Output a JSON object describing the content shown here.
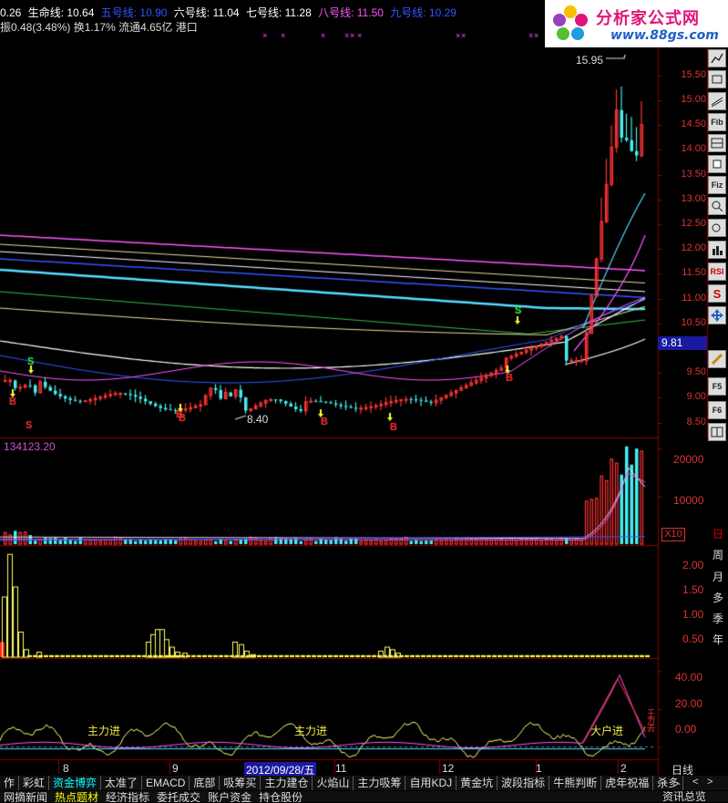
{
  "header": {
    "lines": [
      {
        "label": "0.26",
        "color": "#ffffff"
      },
      {
        "label": "生命线: 10.64",
        "color": "#ffffff"
      },
      {
        "label": "五号线: 10.90",
        "color": "#3355ff"
      },
      {
        "label": "六号线: 11.04",
        "color": "#ffffff"
      },
      {
        "label": "七号线: 11.28",
        "color": "#ffffff"
      },
      {
        "label": "八号线: 11.50",
        "color": "#ff55ff"
      },
      {
        "label": "九号线: 10.29",
        "color": "#3355ff"
      }
    ],
    "info_line": "振0.48(3.48%) 换1.17% 流通4.65亿 港口"
  },
  "logo": {
    "name": "分析家公式网",
    "url": "www.88gs.com"
  },
  "price_axis": {
    "labels": [
      "15.50",
      "15.00",
      "14.50",
      "14.00",
      "13.50",
      "13.00",
      "12.50",
      "12.00",
      "11.50",
      "11.00",
      "10.50",
      "10.00",
      "9.50",
      "9.00",
      "8.50"
    ],
    "current_price": "9.81",
    "high_label": "15.95",
    "low_label": "8.40"
  },
  "volume_panel": {
    "value_label": "134123.20",
    "axis_labels": [
      "20000",
      "10000"
    ],
    "unit_label": "X10"
  },
  "indicator_panel": {
    "axis_labels": [
      "2.00",
      "1.50",
      "1.00",
      "0.50"
    ]
  },
  "oscillator_panel": {
    "axis_labels": [
      "40.00",
      "20.00",
      "0.00"
    ],
    "annotations": [
      "主力进",
      "主力进",
      "大户进"
    ]
  },
  "date_axis": {
    "labels": [
      "8",
      "9",
      "2012/09/28/五",
      "11",
      "12",
      "1",
      "2"
    ],
    "period": "日线"
  },
  "right_toolbar": {
    "tools": [
      "line-icon",
      "box-icon",
      "Fib",
      "box2-icon",
      "Fiz",
      "zoom-icon",
      "RSI",
      "S",
      "move-icon",
      "pencil-icon",
      "F5",
      "F6"
    ],
    "cycles": [
      "日",
      "周",
      "月",
      "多",
      "季",
      "年"
    ],
    "nav": [
      "+",
      "-",
      "<",
      ">"
    ]
  },
  "tabs_row1": [
    "作",
    "彩虹",
    "资金博弈",
    "太准了",
    "EMACD",
    "底部",
    "吸筹买",
    "主力建仓",
    "火焰山",
    "主力吸筹",
    "自用KDJ",
    "黄金坑",
    "波段指标",
    "牛熊判断",
    "虎年祝福",
    "杀多"
  ],
  "tabs_row1_active": "资金博弈",
  "tabs_row2": [
    "网摘新闻",
    "热点题材",
    "经济指标",
    "委托成交",
    "账户资金",
    "持仓股份"
  ],
  "tabs_row2_active": "热点题材",
  "status_right": "资讯总览",
  "chart_data": {
    "type": "line",
    "note_series": "candlestick price chart with moving averages, volume, and indicator subpanels",
    "ylim": [
      8.2,
      16.1
    ],
    "y_ticks": [
      15.5,
      15.0,
      14.5,
      14.0,
      13.5,
      13.0,
      12.5,
      12.0,
      11.5,
      11.0,
      10.5,
      10.0,
      9.5,
      9.0,
      8.5
    ],
    "volume_ylim": [
      0,
      22000
    ],
    "volume_ticks": [
      20000,
      10000
    ],
    "indicator_ylim": [
      0,
      2.2
    ],
    "indicator_ticks": [
      2.0,
      1.5,
      1.0,
      0.5
    ],
    "osc_ylim": [
      -6,
      46
    ],
    "osc_ticks": [
      40,
      20,
      0
    ],
    "signals": [
      {
        "type": "B",
        "idx": 2
      },
      {
        "type": "S",
        "idx": 6
      },
      {
        "type": "B",
        "idx": 37
      },
      {
        "type": "B",
        "idx": 38
      },
      {
        "type": "B",
        "idx": 67
      },
      {
        "type": "B",
        "idx": 82
      },
      {
        "type": "S",
        "idx": 108
      },
      {
        "type": "B",
        "idx": 107
      }
    ]
  },
  "colors": {
    "up": "#ff3333",
    "down": "#44eeee",
    "grid": "#8b0000",
    "axis_text": "#ff5555"
  }
}
